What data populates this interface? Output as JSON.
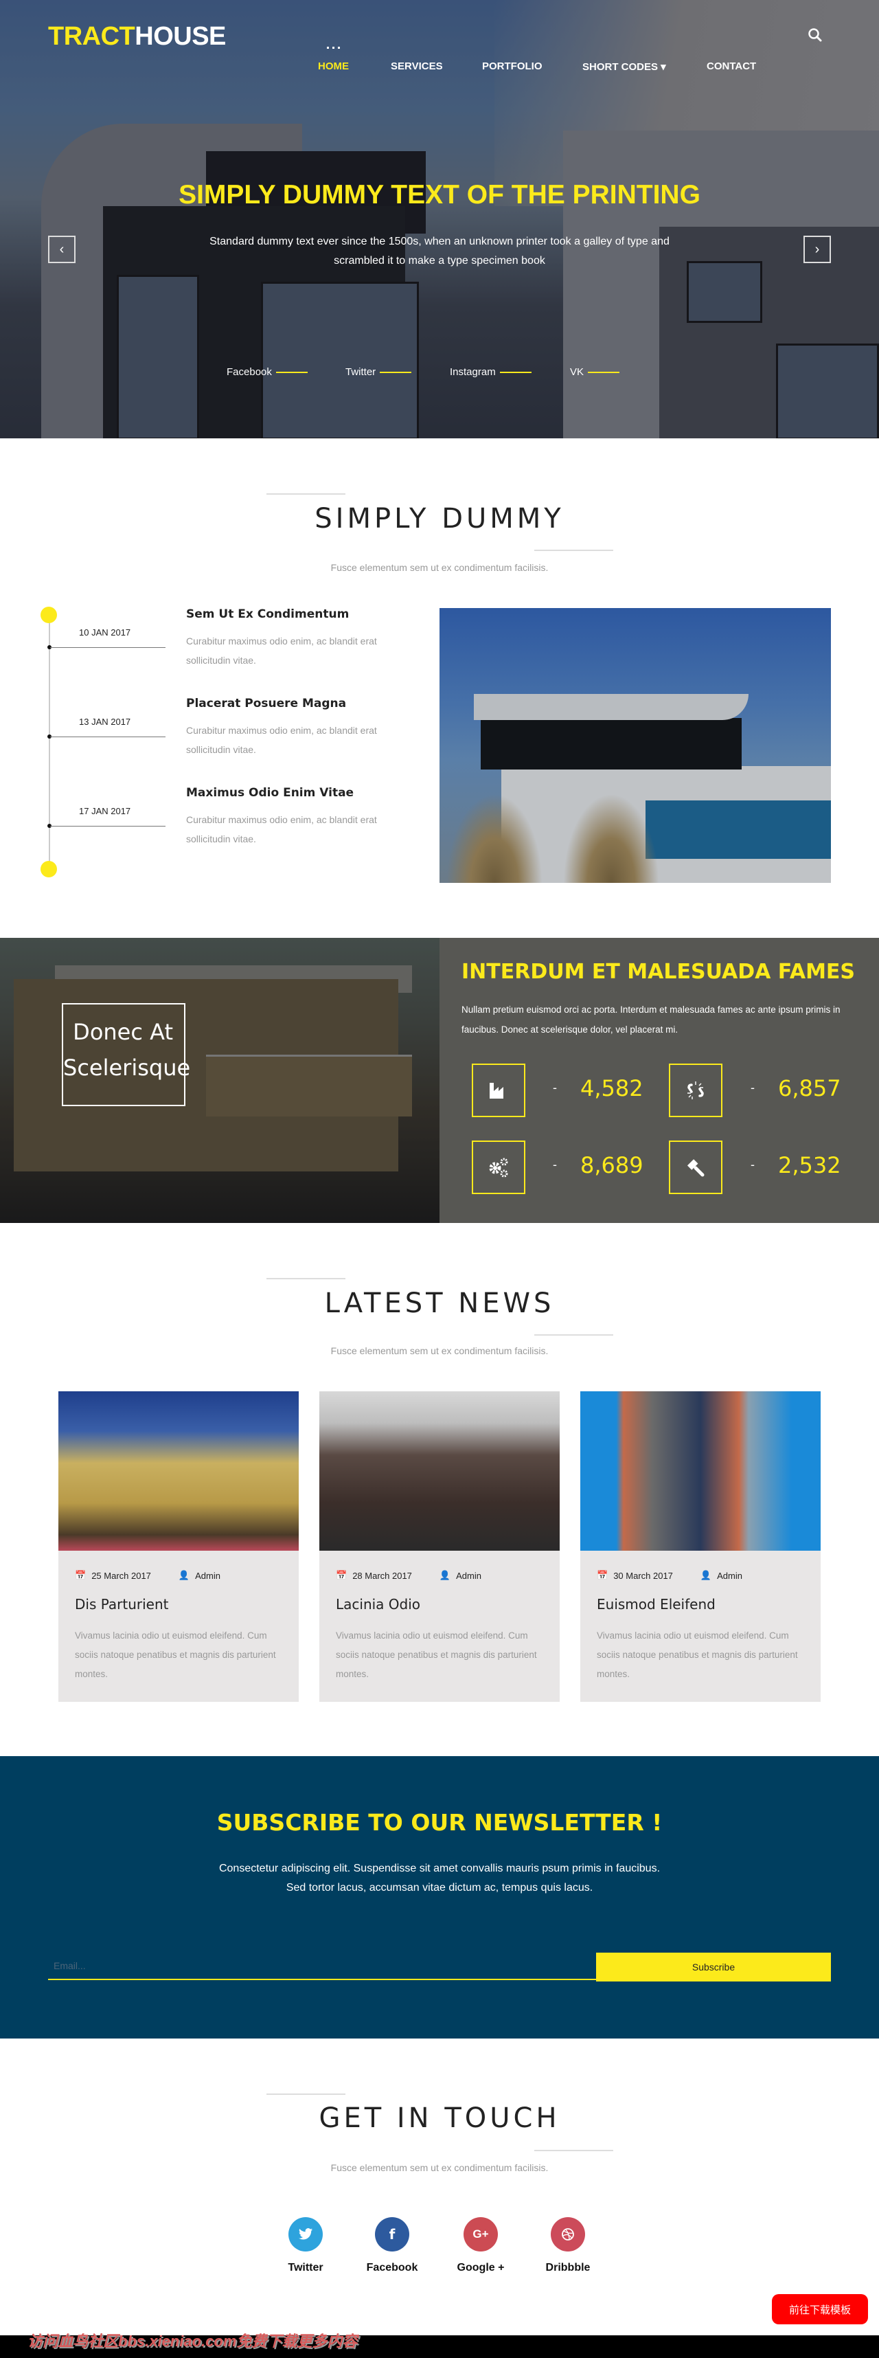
{
  "header": {
    "logo_part1": "TRACT",
    "logo_part2": "HOUSE",
    "nav": [
      {
        "label": "HOME",
        "active": true
      },
      {
        "label": "SERVICES"
      },
      {
        "label": "PORTFOLIO"
      },
      {
        "label": "SHORT CODES ▾"
      },
      {
        "label": "CONTACT"
      }
    ],
    "search_icon": "search-icon"
  },
  "hero": {
    "title": "SIMPLY DUMMY TEXT OF THE PRINTING",
    "subtitle": "Standard dummy text ever since the 1500s, when an unknown printer took a galley of type and scrambled it to make a type specimen book",
    "prev_icon": "‹",
    "next_icon": "›",
    "social": [
      "Facebook",
      "Twitter",
      "Instagram",
      "VK"
    ]
  },
  "about": {
    "title": "SIMPLY DUMMY",
    "subtitle": "Fusce elementum sem ut ex condimentum facilisis.",
    "timeline": [
      {
        "date": "10 JAN 2017",
        "title": "Sem Ut Ex Condimentum",
        "desc": "Curabitur maximus odio enim, ac blandit erat sollicitudin vitae."
      },
      {
        "date": "13 JAN 2017",
        "title": "Placerat Posuere Magna",
        "desc": "Curabitur maximus odio enim, ac blandit erat sollicitudin vitae."
      },
      {
        "date": "17 JAN 2017",
        "title": "Maximus Odio Enim Vitae",
        "desc": "Curabitur maximus odio enim, ac blandit erat sollicitudin vitae."
      }
    ]
  },
  "stats": {
    "box_text": "Donec At Scelerisque",
    "title": "INTERDUM ET MALESUADA FAMES",
    "desc": "Nullam pretium euismod orci ac porta. Interdum et malesuada fames ac ante ipsum primis in faucibus. Donec at scelerisque dolor, vel placerat mi.",
    "dash": "-",
    "items": [
      {
        "icon": "factory-icon",
        "value": "4,582"
      },
      {
        "icon": "broken-link-icon",
        "value": "6,857"
      },
      {
        "icon": "gears-icon",
        "value": "8,689"
      },
      {
        "icon": "gavel-icon",
        "value": "2,532"
      }
    ]
  },
  "news": {
    "title": "LATEST NEWS",
    "subtitle": "Fusce elementum sem ut ex condimentum facilisis.",
    "cards": [
      {
        "date": "25 March 2017",
        "author": "Admin",
        "title": "Dis Parturient",
        "desc": "Vivamus lacinia odio ut euismod eleifend. Cum sociis natoque penatibus et magnis dis parturient montes."
      },
      {
        "date": "28 March 2017",
        "author": "Admin",
        "title": "Lacinia Odio",
        "desc": "Vivamus lacinia odio ut euismod eleifend. Cum sociis natoque penatibus et magnis dis parturient montes."
      },
      {
        "date": "30 March 2017",
        "author": "Admin",
        "title": "Euismod Eleifend",
        "desc": "Vivamus lacinia odio ut euismod eleifend. Cum sociis natoque penatibus et magnis dis parturient montes."
      }
    ]
  },
  "newsletter": {
    "title": "SUBSCRIBE TO OUR NEWSLETTER !",
    "line1": "Consectetur adipiscing elit. Suspendisse sit amet convallis mauris psum primis in faucibus.",
    "line2": "Sed tortor lacus, accumsan vitae dictum ac, tempus quis lacus.",
    "email_placeholder": "Email...",
    "email_value": "",
    "button": "Subscribe"
  },
  "contact": {
    "title": "GET IN TOUCH",
    "subtitle": "Fusce elementum sem ut ex condimentum facilisis.",
    "social": [
      {
        "label": "Twitter",
        "glyph": "🐦",
        "color": "#2ea3dd"
      },
      {
        "label": "Facebook",
        "glyph": "f",
        "color": "#2d5a9e"
      },
      {
        "label": "Google +",
        "glyph": "G+",
        "color": "#cc4b53"
      },
      {
        "label": "Dribbble",
        "glyph": "◍",
        "color": "#cc4b5a"
      }
    ]
  },
  "footer": {
    "download_button": "前往下载模板",
    "watermark": "访问血鸟社区bbs.xieniao.com免费下载更多内容"
  },
  "colors": {
    "accent": "#fcea1b",
    "newsletter_bg": "#003e5f",
    "stats_bg": "#575753",
    "card_bg": "#e8e6e6"
  }
}
